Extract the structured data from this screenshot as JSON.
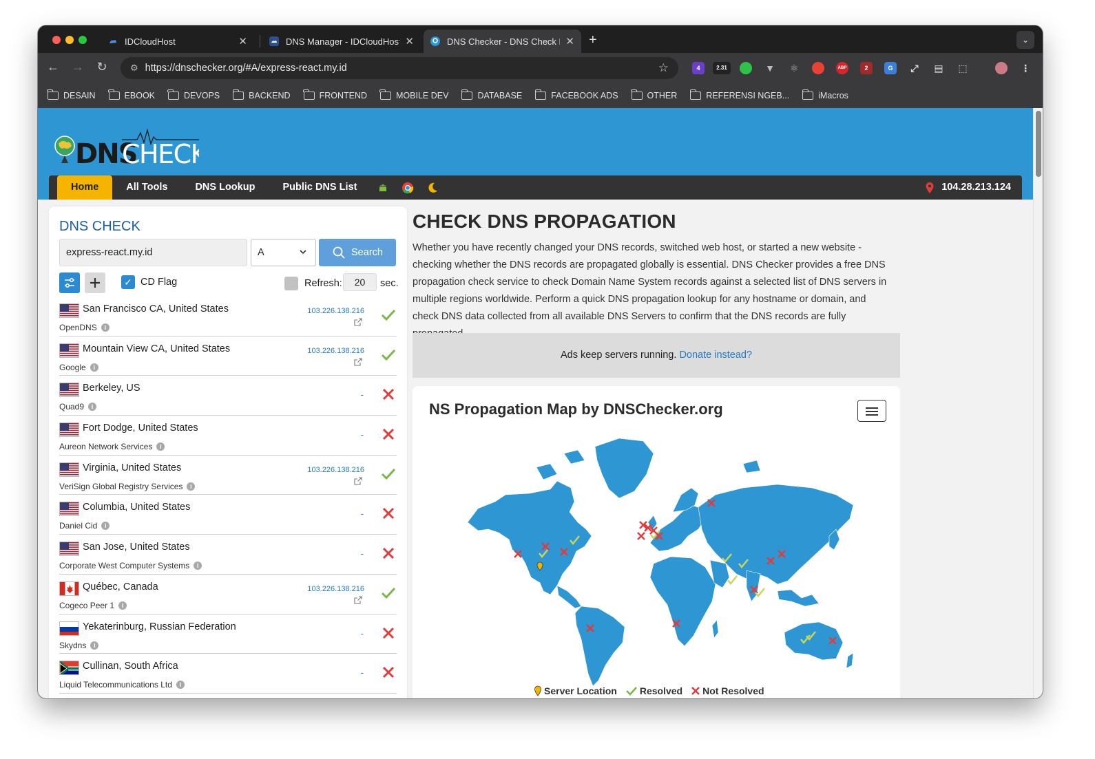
{
  "browser": {
    "tabs": [
      {
        "title": "IDCloudHost",
        "active": false
      },
      {
        "title": "DNS Manager - IDCloudHost",
        "active": false
      },
      {
        "title": "DNS Checker - DNS Check P",
        "active": true
      }
    ],
    "url": "https://dnschecker.org/#A/express-react.my.id",
    "extension_badges": [
      "4",
      "2.31",
      "ABP",
      "2"
    ],
    "bookmarks": [
      "DESAIN",
      "EBOOK",
      "DEVOPS",
      "BACKEND",
      "FRONTEND",
      "MOBILE DEV",
      "DATABASE",
      "FACEBOOK ADS",
      "OTHER",
      "REFERENSI NGEB...",
      "iMacros"
    ]
  },
  "site": {
    "logo": "DNSCHECKER",
    "nav": [
      "Home",
      "All Tools",
      "DNS Lookup",
      "Public DNS List"
    ],
    "ip_address": "104.28.213.124"
  },
  "dns_check": {
    "title": "DNS CHECK",
    "domain": "express-react.my.id",
    "record_type": "A",
    "search_label": "Search",
    "cd_flag_label": "CD Flag",
    "cd_flag_checked": true,
    "refresh_label": "Refresh:",
    "refresh_value": "20",
    "refresh_unit": "sec.",
    "servers": [
      {
        "location": "San Francisco CA, United States",
        "provider": "OpenDNS",
        "ip": "103.226.138.216",
        "status": "resolved",
        "flag": "us"
      },
      {
        "location": "Mountain View CA, United States",
        "provider": "Google",
        "ip": "103.226.138.216",
        "status": "resolved",
        "flag": "us"
      },
      {
        "location": "Berkeley, US",
        "provider": "Quad9",
        "ip": "-",
        "status": "not_resolved",
        "flag": "us"
      },
      {
        "location": "Fort Dodge, United States",
        "provider": "Aureon Network Services",
        "ip": "-",
        "status": "not_resolved",
        "flag": "us"
      },
      {
        "location": "Virginia, United States",
        "provider": "VeriSign Global Registry Services",
        "ip": "103.226.138.216",
        "status": "resolved",
        "flag": "us"
      },
      {
        "location": "Columbia, United States",
        "provider": "Daniel Cid",
        "ip": "-",
        "status": "not_resolved",
        "flag": "us"
      },
      {
        "location": "San Jose, United States",
        "provider": "Corporate West Computer Systems",
        "ip": "-",
        "status": "not_resolved",
        "flag": "us"
      },
      {
        "location": "Québec, Canada",
        "provider": "Cogeco Peer 1",
        "ip": "103.226.138.216",
        "status": "resolved",
        "flag": "ca"
      },
      {
        "location": "Yekaterinburg, Russian Federation",
        "provider": "Skydns",
        "ip": "-",
        "status": "not_resolved",
        "flag": "ru"
      },
      {
        "location": "Cullinan, South Africa",
        "provider": "Liquid Telecommunications Ltd",
        "ip": "-",
        "status": "not_resolved",
        "flag": "za"
      }
    ]
  },
  "content": {
    "heading": "CHECK DNS PROPAGATION",
    "description": "Whether you have recently changed your DNS records, switched web host, or started a new website - checking whether the DNS records are propagated globally is essential. DNS Checker provides a free DNS propagation check service to check Domain Name System records against a selected list of DNS servers in multiple regions worldwide. Perform a quick DNS propagation lookup for any hostname or domain, and check DNS data collected from all available DNS Servers to confirm that the DNS records are fully propagated.",
    "ad_text": "Ads keep servers running.",
    "ad_link": "Donate instead?",
    "map_title": "NS Propagation Map by DNSChecker.org",
    "legend": [
      "Server Location",
      "Resolved",
      "Not Resolved"
    ]
  },
  "colors": {
    "header_blue": "#2e96d3",
    "nav_dark": "#333333",
    "home_yellow": "#f5b400",
    "resolved_green": "#7ab648",
    "not_resolved_red": "#e03c3c",
    "map_land": "#2e96d3"
  }
}
